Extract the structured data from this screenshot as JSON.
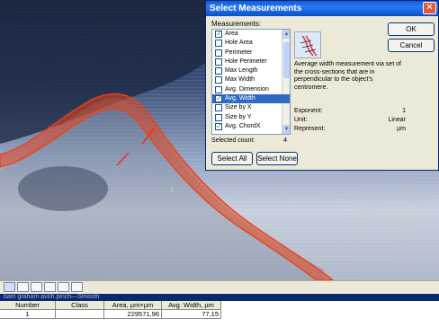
{
  "dialog": {
    "title": "Select Measurements",
    "close_glyph": "✕",
    "measurements_label": "Measurements:",
    "items": [
      {
        "label": "Area",
        "checked": true,
        "selected": false
      },
      {
        "label": "Hole Area",
        "checked": false,
        "selected": false
      },
      {
        "label": "Perimeter",
        "checked": false,
        "selected": false
      },
      {
        "label": "Hole Perimeter",
        "checked": false,
        "selected": false
      },
      {
        "label": "Max Length",
        "checked": false,
        "selected": false
      },
      {
        "label": "Max Width",
        "checked": false,
        "selected": false
      },
      {
        "label": "Avg. Dimension",
        "checked": false,
        "selected": false
      },
      {
        "label": "Avg. Width",
        "checked": true,
        "selected": true
      },
      {
        "label": "Size by X",
        "checked": false,
        "selected": false
      },
      {
        "label": "Size by Y",
        "checked": false,
        "selected": false
      },
      {
        "label": "Avg. ChordX",
        "checked": true,
        "selected": false
      }
    ],
    "selected_count_label": "Selected count:",
    "selected_count": "4",
    "description": "Average width measurement via set of the cross-sections that are in perpendicular to the object's centromere.",
    "exponent_label": "Exponent:",
    "exponent_value": "1",
    "unit_label": "Unit:",
    "unit_value": "Linear",
    "represent_label": "Represent:",
    "represent_value": "µm",
    "ok_label": "OK",
    "cancel_label": "Cancel",
    "select_all_label": "Select All",
    "select_none_label": "Select None",
    "accent_color": "#316ac5"
  },
  "table": {
    "title": "bam graham avoh pinch—Smooth",
    "headers": [
      "Number",
      "Class",
      "Area, µm×µm",
      "Avg. Width, µm"
    ],
    "row": [
      "1",
      "",
      "229571,96",
      "77,15"
    ]
  },
  "toolbar": {
    "icons": [
      "image-icon",
      "table-icon",
      "grid-icon",
      "histogram-icon",
      "chart-icon",
      "arrow-icon"
    ]
  },
  "colors": {
    "outline": "#e8441c",
    "dialog_title": "#0a5fe0"
  }
}
